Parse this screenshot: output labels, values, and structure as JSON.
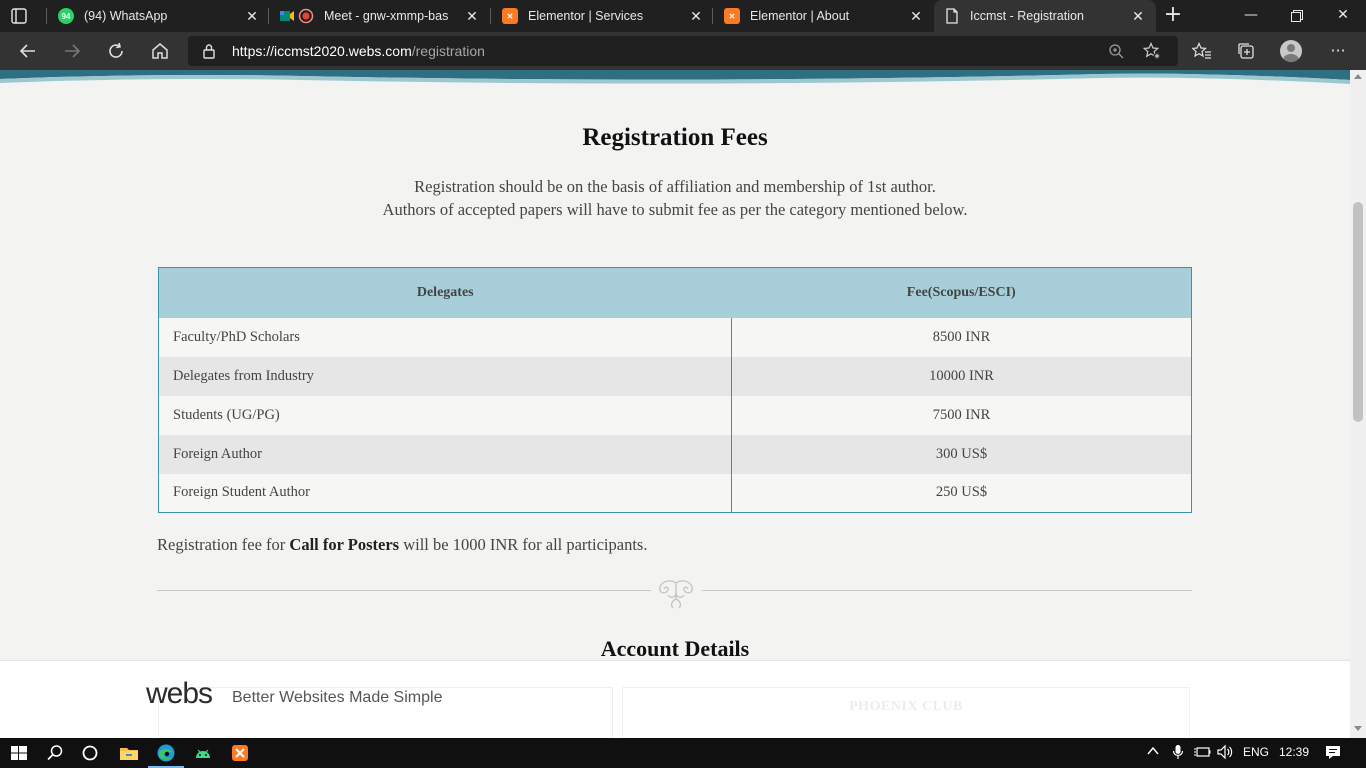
{
  "browser": {
    "tabs": [
      {
        "title": "(94) WhatsApp",
        "badge": "94",
        "icon": "whatsapp-icon",
        "color": "#25d366"
      },
      {
        "title": "Meet - gnw-xmmp-bas",
        "icon": "google-meet-icon",
        "color": "#00897b"
      },
      {
        "title": "Elementor | Services",
        "icon": "xampp-icon",
        "color": "#fb7a24"
      },
      {
        "title": "Elementor | About",
        "icon": "xampp-icon",
        "color": "#fb7a24"
      },
      {
        "title": "Iccmst - Registration",
        "icon": "page-icon",
        "color": "#ffffff"
      }
    ],
    "url_host": "https://iccmst2020.webs.com",
    "url_path": "/registration"
  },
  "page": {
    "heading": "Registration Fees",
    "intro_line1": "Registration should be on the basis of affiliation and membership of 1st author.",
    "intro_line2": "Authors of accepted papers will have to submit fee as per the category mentioned below.",
    "table": {
      "headers": [
        "Delegates",
        "Fee(Scopus/ESCI)"
      ],
      "rows": [
        {
          "category": "Faculty/PhD Scholars",
          "fee": "8500 INR"
        },
        {
          "category": "Delegates from Industry",
          "fee": "10000 INR"
        },
        {
          "category": "Students (UG/PG)",
          "fee": "7500 INR"
        },
        {
          "category": "Foreign Author",
          "fee": "300 US$"
        },
        {
          "category": "Foreign Student Author",
          "fee": "250 US$"
        }
      ]
    },
    "poster_prefix": "Registration fee for ",
    "poster_bold": "Call for Posters",
    "poster_suffix": " will be 1000 INR for all participants.",
    "account_heading": "Account Details",
    "partial_text": "PHOENIX CLUB"
  },
  "banner": {
    "logo": "webs",
    "tagline": "Better Websites Made Simple"
  },
  "taskbar": {
    "language": "ENG",
    "time": "12:39"
  },
  "colors": {
    "table_header": "#a8cfd9",
    "table_border": "#3f8fae",
    "page_bg": "#f3f3f1"
  }
}
